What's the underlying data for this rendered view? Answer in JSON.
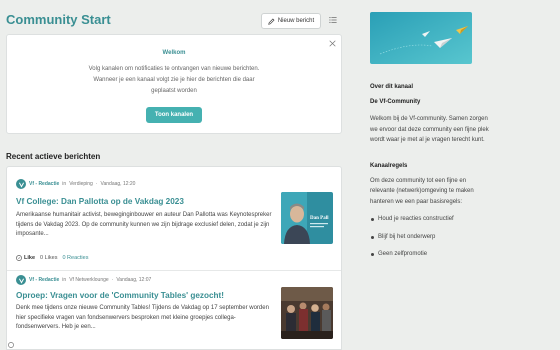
{
  "header": {
    "title": "Community Start",
    "new_post_label": "Nieuw bericht"
  },
  "welcome": {
    "title": "Welkom",
    "text": "Volg kanalen om notificaties te ontvangen van nieuwe berichten. Wanneer je een kanaal volgt zie je hier de berichten die daar geplaatst worden",
    "button_label": "Toon kanalen"
  },
  "recent": {
    "heading": "Recent actieve berichten",
    "posts": [
      {
        "author": "Vf - Redactie",
        "channel_prefix": "in",
        "channel": "Verdieping",
        "time": "Vandaag, 12:20",
        "title": "Vf College: Dan Pallotta op de Vakdag 2023",
        "excerpt": "Amerikaanse humanitair activist, beweginginbouwer en auteur Dan Pallotta was Keynotespreker tijdens de Vakdag 2023. Op de community kunnen we zijn bijdrage exclusief delen, zodat je zijn imposante...",
        "thumb_text": "Dan Pall",
        "like_label": "Like",
        "likes": "0 Likes",
        "reacties": "0 Reacties"
      },
      {
        "author": "Vf - Redactie",
        "channel_prefix": "in",
        "channel": "Vf Netwerklounge",
        "time": "Vandaag, 12:07",
        "title": "Oproep: Vragen voor de 'Community Tables' gezocht!",
        "excerpt": "Denk mee tijdens onze nieuwe Community Tables! Tijdens de Vakdag op 17 september worden hier specifieke vragen van fondsenwervers besproken met kleine groepjes collega-fondsenwervers. Heb je een..."
      }
    ]
  },
  "sidebar": {
    "about_heading": "Over dit kanaal",
    "community_name": "De Vf-Community",
    "about_text": "Welkom bij de Vf-community. Samen zorgen we ervoor dat deze community een fijne plek wordt waar je met al je vragen terecht kunt.",
    "rules_heading": "Kanaalregels",
    "rules_text": "Om deze community tot een fijne en relevante (netwerk)omgeving te maken hanteren we een paar basisregels:",
    "rules": [
      "Houd je reacties constructief",
      "Blijf bij het onderwerp",
      "Geen zelfpromotie"
    ]
  },
  "colors": {
    "accent": "#3a8f93",
    "button": "#45b1b1",
    "background": "#eceeec",
    "banner": "#3db3c4"
  },
  "icons": [
    "pencil-icon",
    "list-icon",
    "close-icon",
    "vf-logo-icon",
    "like-icon",
    "paper-plane-icon"
  ]
}
